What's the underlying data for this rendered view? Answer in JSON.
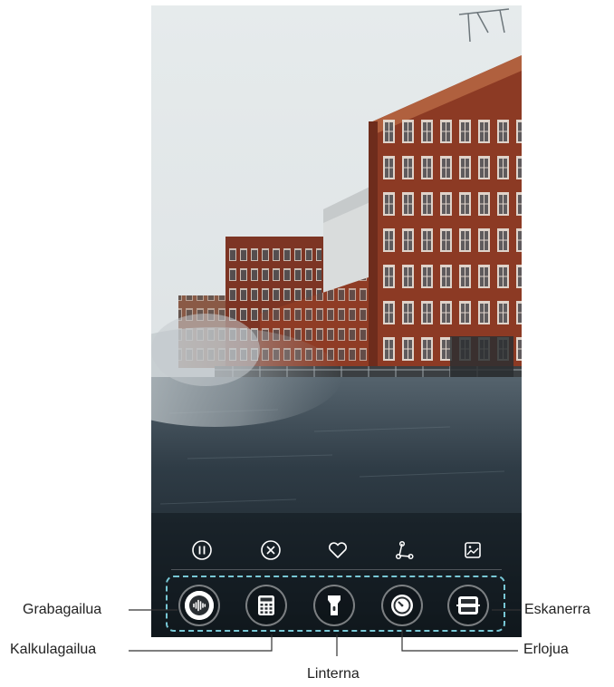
{
  "photo": {
    "subject": "red-brick-factory-by-river"
  },
  "action_bar": {
    "items": [
      {
        "icon": "pause-icon"
      },
      {
        "icon": "close-icon"
      },
      {
        "icon": "heart-icon"
      },
      {
        "icon": "share-icon"
      },
      {
        "icon": "image-icon"
      }
    ]
  },
  "shortcuts": [
    {
      "icon": "recorder-icon"
    },
    {
      "icon": "calculator-icon"
    },
    {
      "icon": "flashlight-icon"
    },
    {
      "icon": "clock-icon"
    },
    {
      "icon": "scanner-icon"
    }
  ],
  "callouts": {
    "recorder": "Grabagailua",
    "calculator": "Kalkulagailua",
    "flashlight": "Linterna",
    "clock": "Erlojua",
    "scanner": "Eskanerra"
  },
  "colors": {
    "tray_border": "#78c8d6",
    "brick": "#8c3a24",
    "sky": "#dfe4e6",
    "water": "#1e2a33"
  }
}
